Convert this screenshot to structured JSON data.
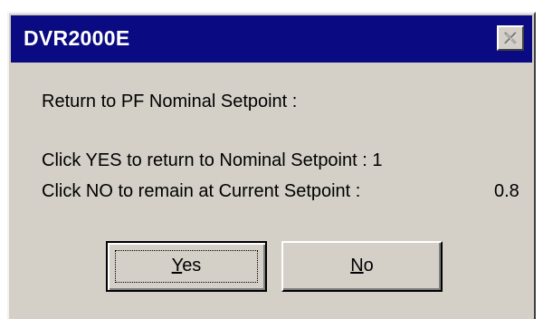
{
  "window": {
    "title": "DVR2000E",
    "close_icon": "close-icon"
  },
  "message": {
    "heading": "Return to PF Nominal Setpoint :",
    "line_yes": "Click YES to return to Nominal Setpoint : 1",
    "line_no": "Click NO to remain at Current Setpoint :",
    "current_value": "0.8"
  },
  "buttons": {
    "yes": {
      "mnemonic": "Y",
      "rest": "es"
    },
    "no": {
      "mnemonic": "N",
      "rest": "o"
    }
  },
  "colors": {
    "titlebar": "#0a0a82",
    "face": "#d4d0c8"
  }
}
